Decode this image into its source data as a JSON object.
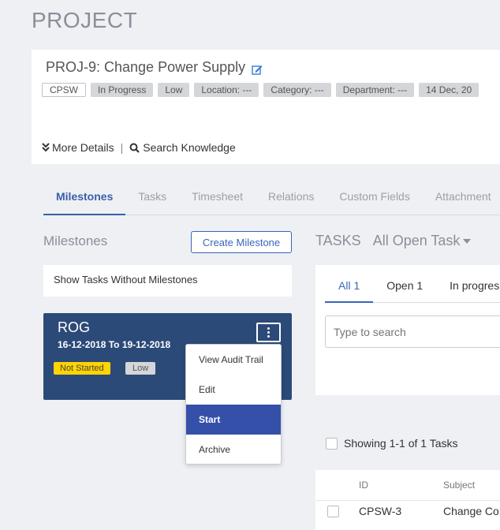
{
  "page": {
    "title": "PROJECT"
  },
  "project": {
    "name": "PROJ-9: Change Power Supply",
    "tags": [
      "CPSW",
      "In Progress",
      "Low",
      "Location: ---",
      "Category: ---",
      "Department: ---",
      "14 Dec, 20"
    ],
    "more_details": "More Details",
    "separator": "|",
    "search_knowledge": "Search Knowledge"
  },
  "tabs": [
    "Milestones",
    "Tasks",
    "Timesheet",
    "Relations",
    "Custom Fields",
    "Attachment"
  ],
  "milestones": {
    "heading": "Milestones",
    "create_button": "Create Milestone",
    "show_without": "Show Tasks Without Milestones",
    "card": {
      "name": "ROG",
      "dates": "16-12-2018 To 19-12-2018",
      "status": "Not Started",
      "priority": "Low"
    },
    "menu": [
      "View Audit Trail",
      "Edit",
      "Start",
      "Archive"
    ]
  },
  "tasks": {
    "title": "TASKS",
    "filter": "All Open Task",
    "tabs": [
      "All 1",
      "Open 1",
      "In progres"
    ],
    "search_placeholder": "Type to search",
    "showing": "Showing 1-1 of 1 Tasks",
    "columns": [
      "ID",
      "Subject"
    ],
    "rows": [
      {
        "id": "CPSW-3",
        "subject": "Change Co"
      }
    ]
  },
  "colors": {
    "accent": "#3a66b8",
    "milestone_card": "#2c4a78",
    "menu_active": "#3450a8",
    "status_yellow": "#ffd400"
  }
}
